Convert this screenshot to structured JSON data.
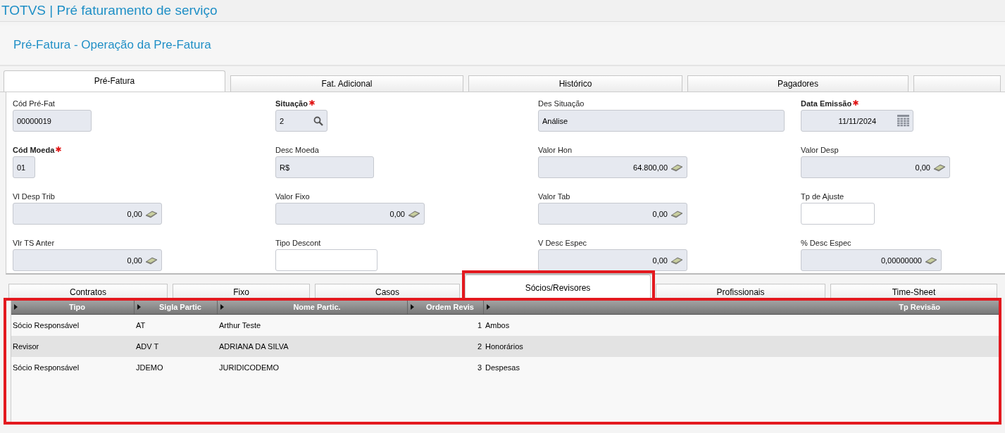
{
  "app_title": "TOTVS | Pré faturamento de serviço",
  "page_title": "Pré-Fatura - Operação da Pre-Fatura",
  "tabs": [
    {
      "label": "Pré-Fatura",
      "selected": true
    },
    {
      "label": "Fat. Adicional",
      "selected": false
    },
    {
      "label": "Histórico",
      "selected": false
    },
    {
      "label": "Pagadores",
      "selected": false
    }
  ],
  "fields": [
    {
      "label": "Cód Pré-Fat",
      "required": false,
      "value": "00000019",
      "kind": "text",
      "disabled": true
    },
    {
      "label": "Situação",
      "required": true,
      "value": "2",
      "kind": "lookup",
      "disabled": true
    },
    {
      "label": "Des Situação",
      "required": false,
      "value": "Análise",
      "kind": "text",
      "disabled": true
    },
    {
      "label": "Data Emissão",
      "required": true,
      "value": "11/11/2024",
      "kind": "date",
      "disabled": true
    },
    {
      "label": "Cód Moeda",
      "required": true,
      "value": "01",
      "kind": "text",
      "disabled": true
    },
    {
      "label": "Desc Moeda",
      "required": false,
      "value": "R$",
      "kind": "text",
      "disabled": true
    },
    {
      "label": "Valor Hon",
      "required": false,
      "value": "64.800,00",
      "kind": "money",
      "disabled": true
    },
    {
      "label": "Valor Desp",
      "required": false,
      "value": "0,00",
      "kind": "money",
      "disabled": true
    },
    {
      "label": "Vl Desp Trib",
      "required": false,
      "value": "0,00",
      "kind": "money",
      "disabled": true
    },
    {
      "label": "Valor Fixo",
      "required": false,
      "value": "0,00",
      "kind": "money",
      "disabled": true
    },
    {
      "label": "Valor Tab",
      "required": false,
      "value": "0,00",
      "kind": "money",
      "disabled": true
    },
    {
      "label": "Tp de Ajuste",
      "required": false,
      "kind": "text",
      "disabled": false
    },
    {
      "label": "Vlr TS Anter",
      "required": false,
      "value": "0,00",
      "kind": "money",
      "disabled": true
    },
    {
      "label": "Tipo Descont",
      "required": false,
      "kind": "text",
      "disabled": false
    },
    {
      "label": "V Desc Espec",
      "required": false,
      "value": "0,00",
      "kind": "money",
      "disabled": true
    },
    {
      "label": "% Desc Espec",
      "required": false,
      "value": "0,00000000",
      "kind": "money",
      "disabled": true
    }
  ],
  "subtabs": [
    {
      "label": "Contratos",
      "selected": false,
      "highlighted": false
    },
    {
      "label": "Fixo",
      "selected": false,
      "highlighted": false
    },
    {
      "label": "Casos",
      "selected": false,
      "highlighted": false
    },
    {
      "label": "Sócios/Revisores",
      "selected": true,
      "highlighted": true
    },
    {
      "label": "Profissionais",
      "selected": false,
      "highlighted": false
    },
    {
      "label": "Time-Sheet",
      "selected": false,
      "highlighted": false
    }
  ],
  "table": {
    "highlighted": true,
    "columns": [
      "Tipo",
      "Sigla Partic",
      "Nome Partic.",
      "Ordem Revis",
      "Tp Revisão"
    ],
    "rows": [
      [
        "Sócio Responsável",
        "AT",
        "Arthur Teste",
        "1",
        "Ambos"
      ],
      [
        "Revisor",
        "ADV T",
        "ADRIANA DA SILVA",
        "2",
        "Honorários"
      ],
      [
        "Sócio Responsável",
        "JDEMO",
        "JURIDICODEMO",
        "3",
        "Despesas"
      ]
    ]
  }
}
